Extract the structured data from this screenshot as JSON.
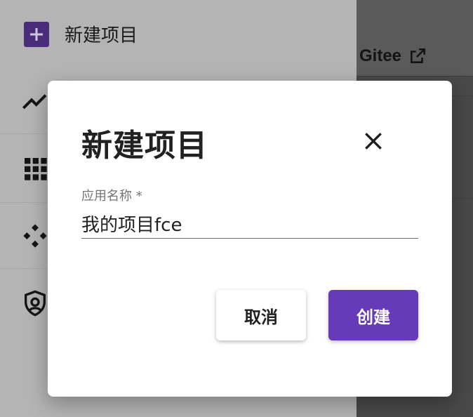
{
  "background": {
    "sidebar": {
      "new_project_label": "新建项目",
      "icons": [
        "trending-up-icon",
        "apps-grid-icon",
        "diamond-shapes-icon",
        "shield-account-icon"
      ]
    },
    "header": {
      "link_label": "Gitee",
      "link_icon": "open-in-new-icon"
    }
  },
  "dialog": {
    "title": "新建项目",
    "close_icon": "close-icon",
    "field": {
      "label": "应用名称 *",
      "value": "我的项目fce"
    },
    "buttons": {
      "cancel": "取消",
      "create": "创建"
    }
  },
  "colors": {
    "accent": "#673ab7",
    "overlay": "#b3b3b3",
    "dialog_bg": "#ffffff"
  }
}
